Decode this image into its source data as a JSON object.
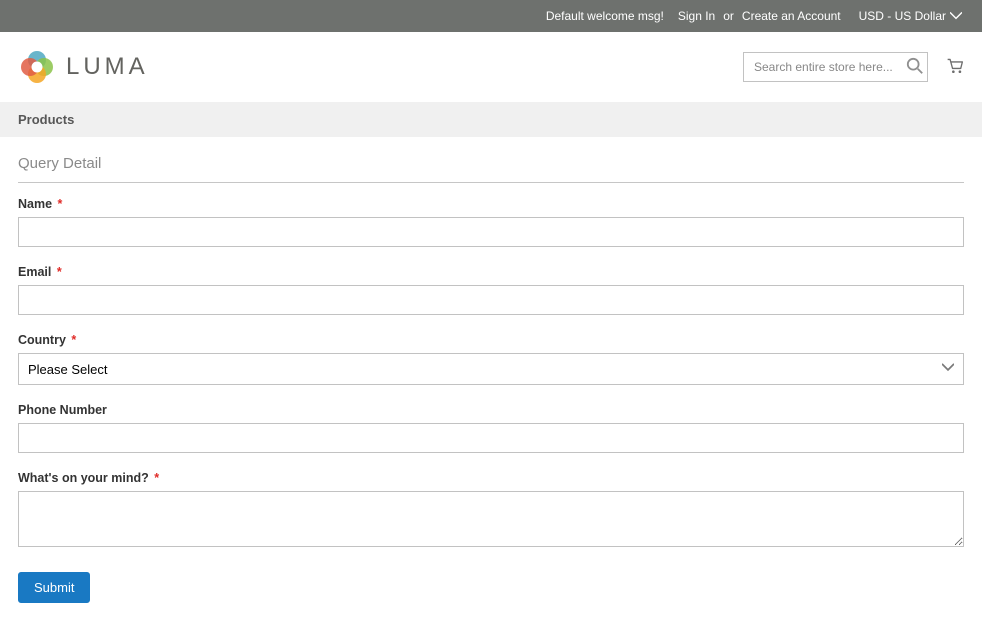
{
  "header": {
    "welcome": "Default welcome msg!",
    "sign_in": "Sign In",
    "or": "or",
    "create_account": "Create an Account",
    "currency": "USD - US Dollar"
  },
  "logo": {
    "text": "LUMA"
  },
  "search": {
    "placeholder": "Search entire store here..."
  },
  "nav": {
    "products": "Products"
  },
  "form": {
    "legend": "Query Detail",
    "name_label": "Name",
    "email_label": "Email",
    "country_label": "Country",
    "country_selected": "Please Select",
    "phone_label": "Phone Number",
    "mind_label": "What's on your mind?",
    "submit": "Submit"
  }
}
